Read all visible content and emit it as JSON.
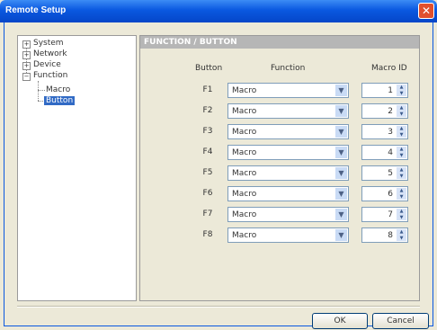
{
  "window": {
    "title": "Remote Setup",
    "close_symbol": "✕"
  },
  "tree": {
    "items": [
      {
        "label": "System",
        "expander": "+"
      },
      {
        "label": "Network",
        "expander": "+"
      },
      {
        "label": "Device",
        "expander": "+"
      },
      {
        "label": "Function",
        "expander": "−"
      }
    ],
    "children": [
      {
        "label": "Macro"
      },
      {
        "label": "Button"
      }
    ]
  },
  "panel": {
    "header": "FUNCTION / BUTTON",
    "columns": {
      "button": "Button",
      "function": "Function",
      "macro_id": "Macro ID"
    },
    "rows": [
      {
        "button": "F1",
        "function": "Macro",
        "macro_id": "1"
      },
      {
        "button": "F2",
        "function": "Macro",
        "macro_id": "2"
      },
      {
        "button": "F3",
        "function": "Macro",
        "macro_id": "3"
      },
      {
        "button": "F4",
        "function": "Macro",
        "macro_id": "4"
      },
      {
        "button": "F5",
        "function": "Macro",
        "macro_id": "5"
      },
      {
        "button": "F6",
        "function": "Macro",
        "macro_id": "6"
      },
      {
        "button": "F7",
        "function": "Macro",
        "macro_id": "7"
      },
      {
        "button": "F8",
        "function": "Macro",
        "macro_id": "8"
      }
    ]
  },
  "buttons": {
    "ok": "OK",
    "cancel": "Cancel"
  },
  "colors": {
    "titlebar": "#0a58e0",
    "selection": "#316ac5",
    "panel_header": "#b6b6b6"
  }
}
